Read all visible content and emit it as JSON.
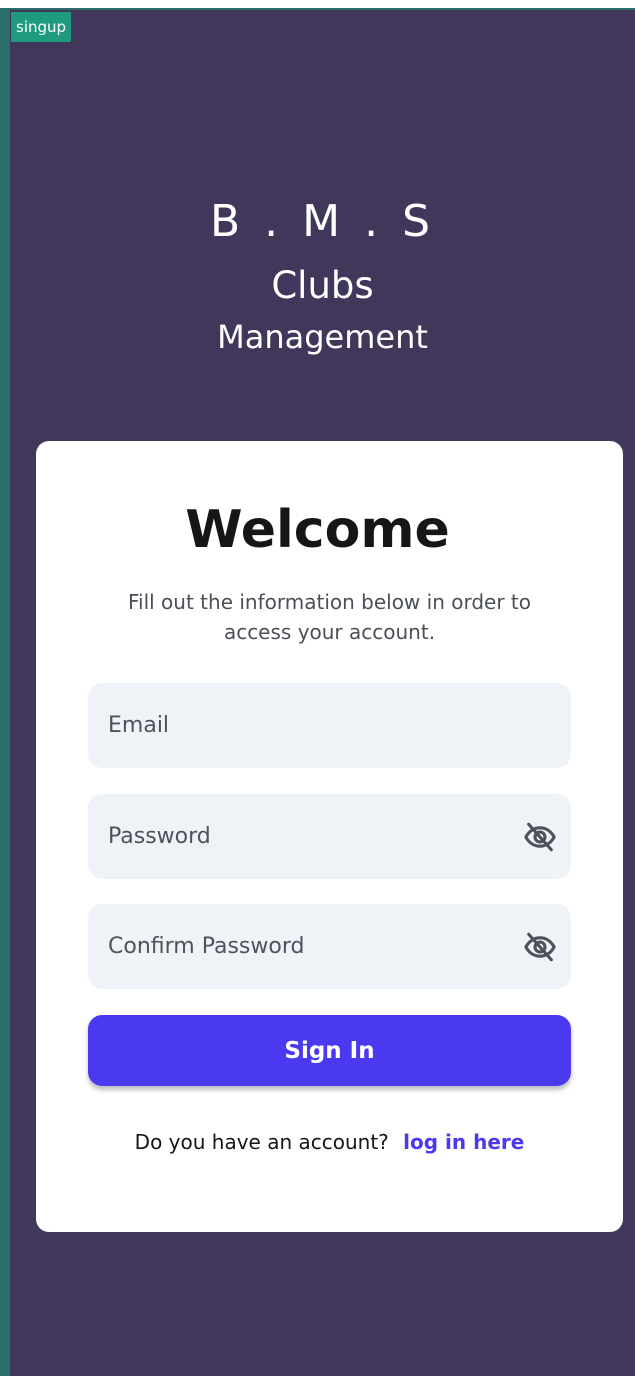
{
  "debug_banner": "singup",
  "brand": {
    "line1": "B . M . S",
    "line2": "Clubs",
    "line3": "Management"
  },
  "card": {
    "title": "Welcome",
    "subtitle_line1": "Fill out the information below in order to",
    "subtitle_line2": "access your account.",
    "fields": {
      "email": {
        "placeholder": "Email",
        "value": ""
      },
      "password": {
        "placeholder": "Password",
        "value": "",
        "toggle_icon": "eye-off-icon"
      },
      "confirm_password": {
        "placeholder": "Confirm Password",
        "value": "",
        "toggle_icon": "eye-off-icon"
      }
    },
    "primary_button": "Sign In",
    "footer_text": "Do you have an account?",
    "footer_link": "log in here"
  },
  "colors": {
    "background": "#40375a",
    "card": "#ffffff",
    "field": "#eff2f7",
    "primary": "#4b39ef",
    "banner": "#1e9a7e"
  }
}
